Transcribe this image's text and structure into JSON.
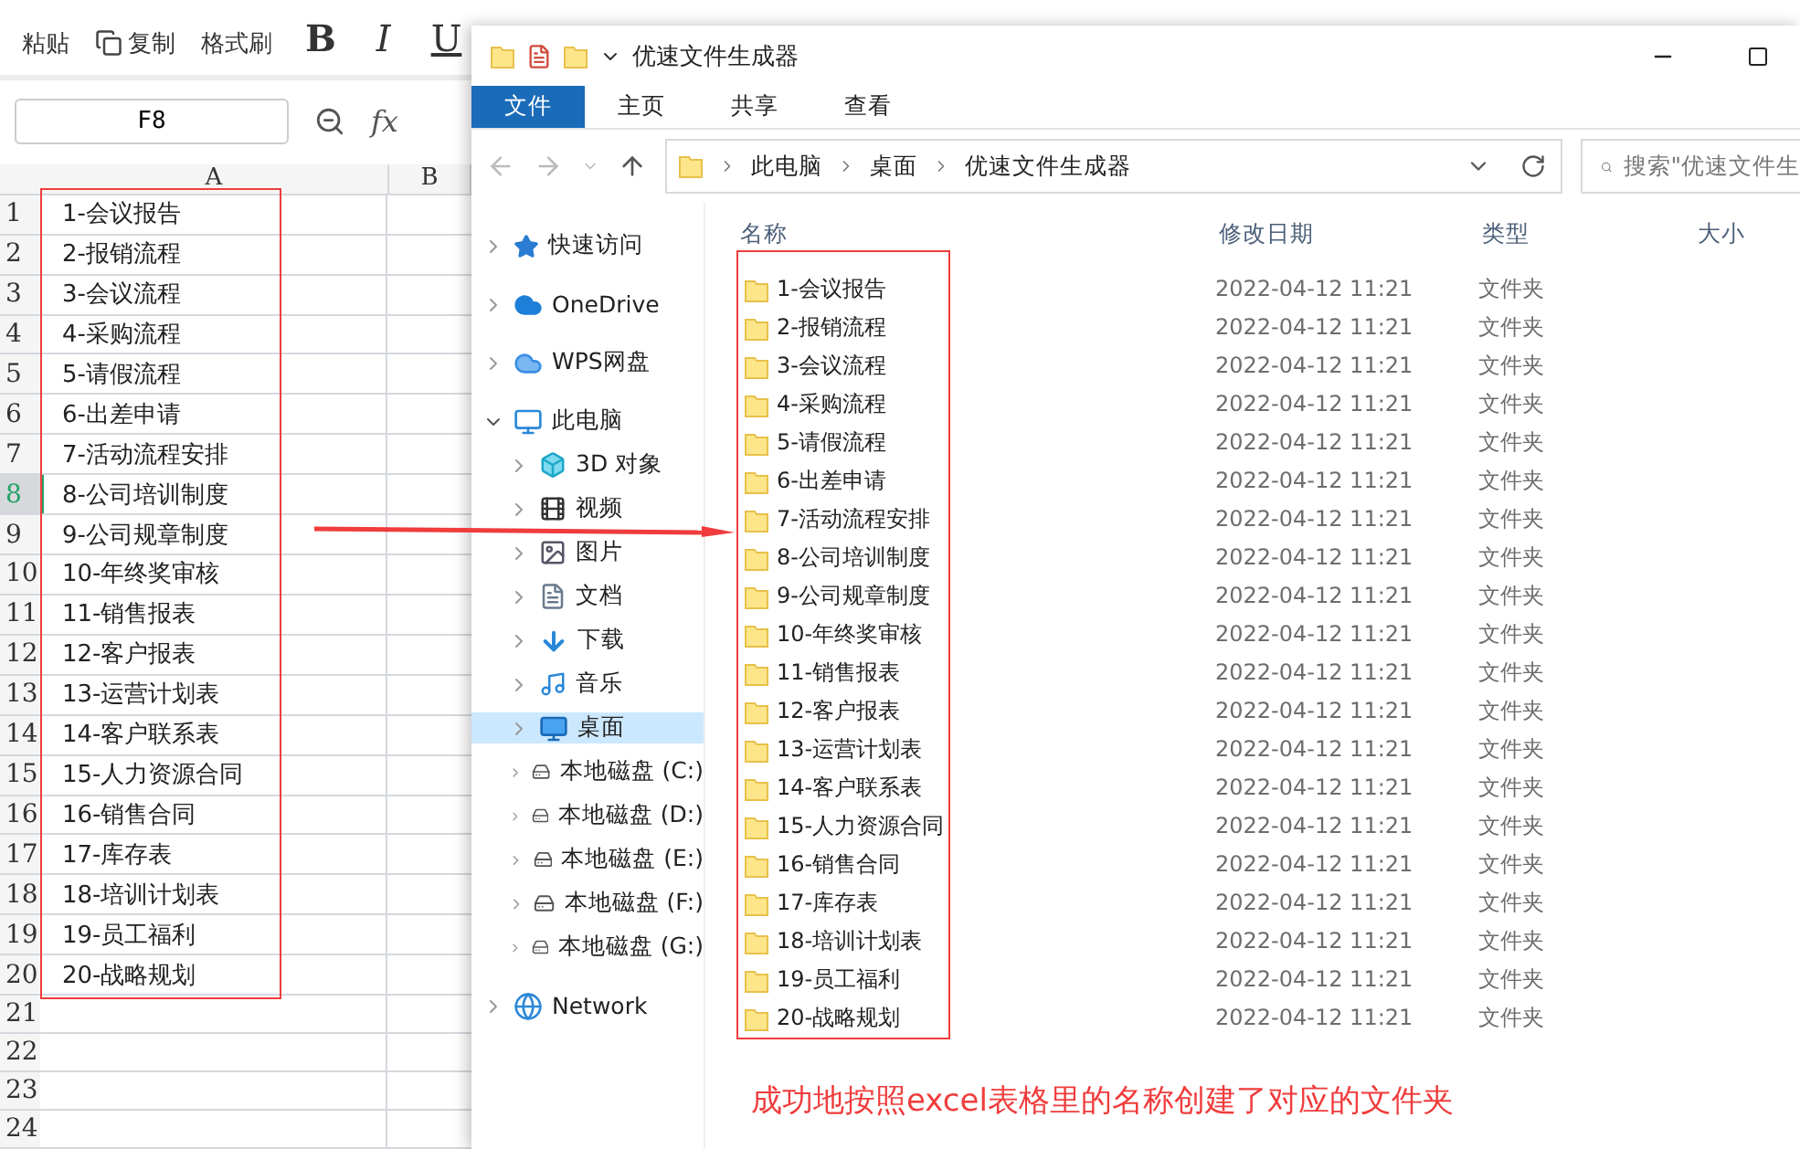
{
  "spreadsheet": {
    "ribbon": [
      {
        "label": "粘贴",
        "kind": "paste"
      },
      {
        "label": "复制",
        "kind": "copy"
      },
      {
        "label": "格式刷",
        "kind": "brush"
      }
    ],
    "format_buttons": [
      "B",
      "I",
      "U"
    ],
    "name_box": "F8",
    "formula_label": "fx",
    "columns": [
      "A",
      "B"
    ],
    "rows": [
      {
        "number": "1",
        "value": "1-会议报告",
        "selected": false
      },
      {
        "number": "2",
        "value": "2-报销流程",
        "selected": false
      },
      {
        "number": "3",
        "value": "3-会议流程",
        "selected": false
      },
      {
        "number": "4",
        "value": "4-采购流程",
        "selected": false
      },
      {
        "number": "5",
        "value": "5-请假流程",
        "selected": false
      },
      {
        "number": "6",
        "value": "6-出差申请",
        "selected": false
      },
      {
        "number": "7",
        "value": "7-活动流程安排",
        "selected": false
      },
      {
        "number": "8",
        "value": "8-公司培训制度",
        "selected": true
      },
      {
        "number": "9",
        "value": "9-公司规章制度",
        "selected": false
      },
      {
        "number": "10",
        "value": "10-年终奖审核",
        "selected": false
      },
      {
        "number": "11",
        "value": "11-销售报表",
        "selected": false
      },
      {
        "number": "12",
        "value": "12-客户报表",
        "selected": false
      },
      {
        "number": "13",
        "value": "13-运营计划表",
        "selected": false
      },
      {
        "number": "14",
        "value": "14-客户联系表",
        "selected": false
      },
      {
        "number": "15",
        "value": "15-人力资源合同",
        "selected": false
      },
      {
        "number": "16",
        "value": "16-销售合同",
        "selected": false
      },
      {
        "number": "17",
        "value": "17-库存表",
        "selected": false
      },
      {
        "number": "18",
        "value": "18-培训计划表",
        "selected": false
      },
      {
        "number": "19",
        "value": "19-员工福利",
        "selected": false
      },
      {
        "number": "20",
        "value": "20-战略规划",
        "selected": false
      },
      {
        "number": "21",
        "selected": false
      },
      {
        "number": "22",
        "selected": false
      },
      {
        "number": "23",
        "selected": false
      },
      {
        "number": "24",
        "selected": false
      }
    ]
  },
  "explorer": {
    "window": {
      "title": "优速文件生成器"
    },
    "tabs": [
      {
        "label": "文件",
        "selected": true
      },
      {
        "label": "主页",
        "selected": false
      },
      {
        "label": "共享",
        "selected": false
      },
      {
        "label": "查看",
        "selected": false
      }
    ],
    "breadcrumb": [
      "此电脑",
      "桌面",
      "优速文件生成器"
    ],
    "search": {
      "placeholder": "搜索\"优速文件生"
    },
    "nav": [
      {
        "label": "快速访问",
        "kind": "star",
        "selected": false,
        "expanded": false
      },
      {
        "label": "OneDrive",
        "kind": "cloud",
        "selected": false,
        "expanded": false
      },
      {
        "label": "WPS网盘",
        "kind": "cloud2",
        "selected": false,
        "expanded": false
      },
      {
        "label": "此电脑",
        "kind": "pc",
        "selected": false,
        "expanded": true,
        "children": [
          {
            "label": "3D 对象",
            "kind": "cube",
            "selected": false,
            "expanded": false
          },
          {
            "label": "视频",
            "kind": "film",
            "selected": false,
            "expanded": false
          },
          {
            "label": "图片",
            "kind": "image",
            "selected": false,
            "expanded": false
          },
          {
            "label": "文档",
            "kind": "doc",
            "selected": false,
            "expanded": false
          },
          {
            "label": "下载",
            "kind": "download",
            "selected": false,
            "expanded": false
          },
          {
            "label": "音乐",
            "kind": "music",
            "selected": false,
            "expanded": false
          },
          {
            "label": "桌面",
            "kind": "desktop",
            "selected": true,
            "expanded": false
          },
          {
            "label": "本地磁盘 (C:)",
            "kind": "drive",
            "selected": false,
            "expanded": false
          },
          {
            "label": "本地磁盘 (D:)",
            "kind": "drive",
            "selected": false,
            "expanded": false
          },
          {
            "label": "本地磁盘 (E:)",
            "kind": "drive",
            "selected": false,
            "expanded": false
          },
          {
            "label": "本地磁盘 (F:)",
            "kind": "drive",
            "selected": false,
            "expanded": false
          },
          {
            "label": "本地磁盘 (G:)",
            "kind": "drive",
            "selected": false,
            "expanded": false
          }
        ]
      },
      {
        "label": "Network",
        "kind": "network",
        "selected": false,
        "expanded": false
      }
    ],
    "columns": [
      "名称",
      "修改日期",
      "类型",
      "大小"
    ],
    "files": [
      {
        "name": "1-会议报告",
        "modified": "2022-04-12 11:21",
        "type": "文件夹"
      },
      {
        "name": "2-报销流程",
        "modified": "2022-04-12 11:21",
        "type": "文件夹"
      },
      {
        "name": "3-会议流程",
        "modified": "2022-04-12 11:21",
        "type": "文件夹"
      },
      {
        "name": "4-采购流程",
        "modified": "2022-04-12 11:21",
        "type": "文件夹"
      },
      {
        "name": "5-请假流程",
        "modified": "2022-04-12 11:21",
        "type": "文件夹"
      },
      {
        "name": "6-出差申请",
        "modified": "2022-04-12 11:21",
        "type": "文件夹"
      },
      {
        "name": "7-活动流程安排",
        "modified": "2022-04-12 11:21",
        "type": "文件夹"
      },
      {
        "name": "8-公司培训制度",
        "modified": "2022-04-12 11:21",
        "type": "文件夹"
      },
      {
        "name": "9-公司规章制度",
        "modified": "2022-04-12 11:21",
        "type": "文件夹"
      },
      {
        "name": "10-年终奖审核",
        "modified": "2022-04-12 11:21",
        "type": "文件夹"
      },
      {
        "name": "11-销售报表",
        "modified": "2022-04-12 11:21",
        "type": "文件夹"
      },
      {
        "name": "12-客户报表",
        "modified": "2022-04-12 11:21",
        "type": "文件夹"
      },
      {
        "name": "13-运营计划表",
        "modified": "2022-04-12 11:21",
        "type": "文件夹"
      },
      {
        "name": "14-客户联系表",
        "modified": "2022-04-12 11:21",
        "type": "文件夹"
      },
      {
        "name": "15-人力资源合同",
        "modified": "2022-04-12 11:21",
        "type": "文件夹"
      },
      {
        "name": "16-销售合同",
        "modified": "2022-04-12 11:21",
        "type": "文件夹"
      },
      {
        "name": "17-库存表",
        "modified": "2022-04-12 11:21",
        "type": "文件夹"
      },
      {
        "name": "18-培训计划表",
        "modified": "2022-04-12 11:21",
        "type": "文件夹"
      },
      {
        "name": "19-员工福利",
        "modified": "2022-04-12 11:21",
        "type": "文件夹"
      },
      {
        "name": "20-战略规划",
        "modified": "2022-04-12 11:21",
        "type": "文件夹"
      }
    ]
  },
  "annotation": "成功地按照excel表格里的名称创建了对应的文件夹"
}
